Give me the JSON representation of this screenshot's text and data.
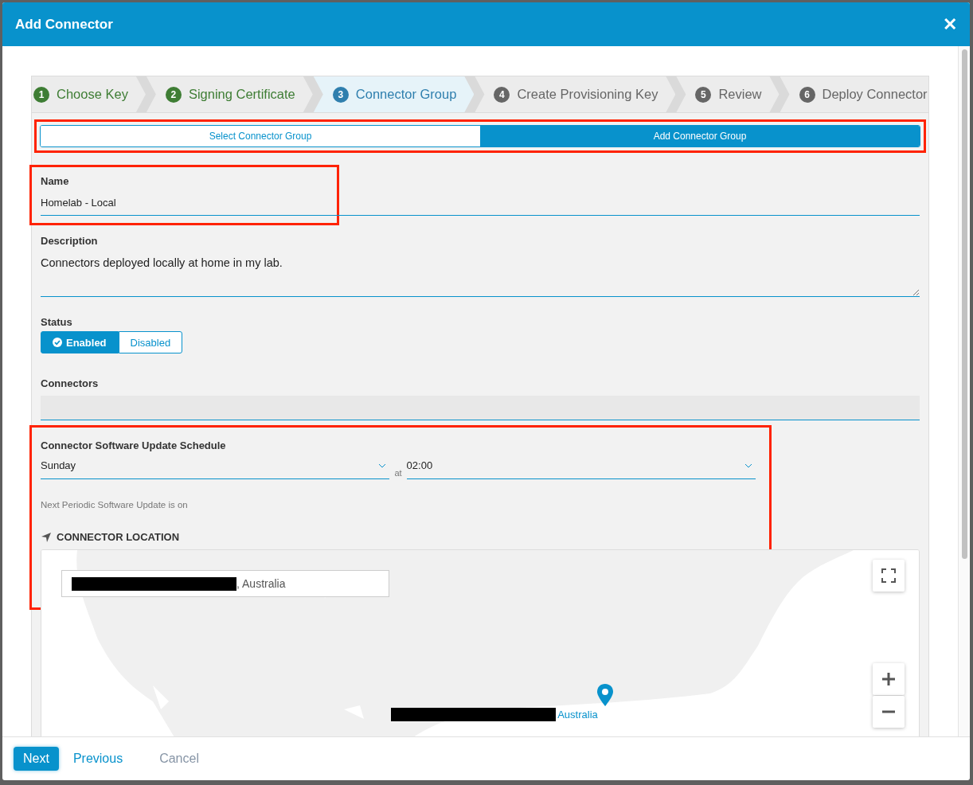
{
  "window": {
    "title": "Add Connector",
    "close_label": "✕"
  },
  "steps": [
    {
      "number": "1",
      "label": "Choose Key",
      "completed": true,
      "selected": false
    },
    {
      "number": "2",
      "label": "Signing Certificate",
      "completed": true,
      "selected": false
    },
    {
      "number": "3",
      "label": "Connector Group",
      "completed": false,
      "selected": true
    },
    {
      "number": "4",
      "label": "Create Provisioning Key",
      "completed": false,
      "selected": false
    },
    {
      "number": "5",
      "label": "Review",
      "completed": false,
      "selected": false
    },
    {
      "number": "6",
      "label": "Deploy Connector",
      "completed": false,
      "selected": false
    }
  ],
  "mode_toggle": {
    "highlighted": true,
    "options": [
      {
        "label": "Select Connector Group",
        "selected": false
      },
      {
        "label": "Add Connector Group",
        "selected": true
      }
    ]
  },
  "name": {
    "label": "Name",
    "value": "Homelab - Local",
    "highlighted": true
  },
  "description": {
    "label": "Description",
    "value": "Connectors deployed locally at home in my lab."
  },
  "status": {
    "label": "Status",
    "options": [
      {
        "label": "Enabled",
        "selected": true
      },
      {
        "label": "Disabled",
        "selected": false
      }
    ]
  },
  "connectors": {
    "label": "Connectors"
  },
  "schedule": {
    "label": "Connector Software Update Schedule",
    "highlighted": true,
    "day": "Sunday",
    "at": "at",
    "time": "02:00",
    "next_update": "Next Periodic Software Update is on"
  },
  "location": {
    "heading": "CONNECTOR LOCATION",
    "search_value": ", Australia",
    "marker_label": "Australia"
  },
  "footer": {
    "buttons": [
      {
        "label": "Next",
        "kind": "primary"
      },
      {
        "label": "Previous",
        "kind": "link"
      },
      {
        "label": "Cancel",
        "kind": "muted"
      }
    ]
  }
}
